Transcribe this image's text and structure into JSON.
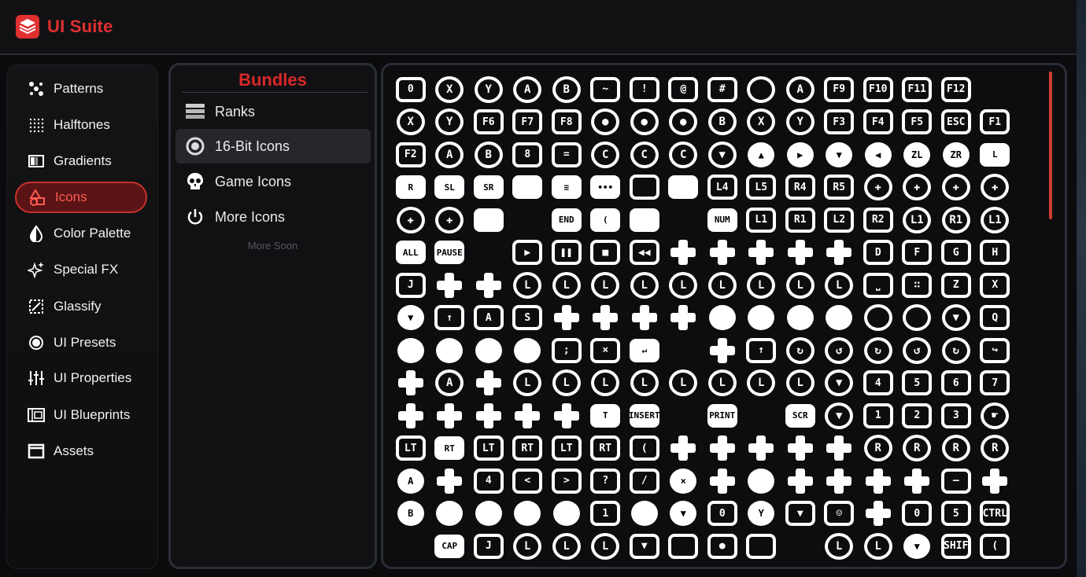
{
  "app": {
    "title": "UI Suite",
    "brand_color": "#e03030"
  },
  "sidebar": {
    "items": [
      {
        "label": "Patterns",
        "icon": "patterns-icon",
        "active": false
      },
      {
        "label": "Halftones",
        "icon": "halftones-icon",
        "active": false
      },
      {
        "label": "Gradients",
        "icon": "gradients-icon",
        "active": false
      },
      {
        "label": "Icons",
        "icon": "icons-icon",
        "active": true
      },
      {
        "label": "Color Palette",
        "icon": "color-palette-icon",
        "active": false
      },
      {
        "label": "Special FX",
        "icon": "sparkles-icon",
        "active": false
      },
      {
        "label": "Glassify",
        "icon": "glassify-icon",
        "active": false
      },
      {
        "label": "UI Presets",
        "icon": "presets-icon",
        "active": false
      },
      {
        "label": "UI Properties",
        "icon": "sliders-icon",
        "active": false
      },
      {
        "label": "UI Blueprints",
        "icon": "blueprints-icon",
        "active": false
      },
      {
        "label": "Assets",
        "icon": "assets-icon",
        "active": false
      }
    ]
  },
  "bundles": {
    "title": "Bundles",
    "items": [
      {
        "label": "Ranks",
        "icon": "ranks-icon",
        "active": false
      },
      {
        "label": "16-Bit Icons",
        "icon": "16bit-icon",
        "active": true
      },
      {
        "label": "Game Icons",
        "icon": "skull-icon",
        "active": false
      },
      {
        "label": "More Icons",
        "icon": "power-icon",
        "active": false
      }
    ],
    "more_soon": "More Soon"
  },
  "icon_grid": {
    "accent": "#d23c32",
    "cells": [
      [
        "sq",
        "0"
      ],
      [
        "circ",
        "X"
      ],
      [
        "circ",
        "Y"
      ],
      [
        "circ",
        "A"
      ],
      [
        "circ",
        "B"
      ],
      [
        "sq",
        "~"
      ],
      [
        "sq",
        "!"
      ],
      [
        "sq",
        "@"
      ],
      [
        "sq",
        "#"
      ],
      [
        "circ",
        ""
      ],
      [
        "circ",
        "A"
      ],
      [
        "sq",
        "F9"
      ],
      [
        "sq",
        "F10"
      ],
      [
        "sq",
        "F11"
      ],
      [
        "sq",
        "F12"
      ],
      [
        "none",
        ""
      ],
      [
        "circ",
        "X"
      ],
      [
        "circ",
        "Y"
      ],
      [
        "sq",
        "F6"
      ],
      [
        "sq",
        "F7"
      ],
      [
        "sq",
        "F8"
      ],
      [
        "circ",
        "●"
      ],
      [
        "circ",
        "●"
      ],
      [
        "circ",
        "●"
      ],
      [
        "circ",
        "B"
      ],
      [
        "circ",
        "X"
      ],
      [
        "circ",
        "Y"
      ],
      [
        "sq",
        "F3"
      ],
      [
        "sq",
        "F4"
      ],
      [
        "sq",
        "F5"
      ],
      [
        "sq",
        "ESC"
      ],
      [
        "sq",
        "F1"
      ],
      [
        "sq",
        "F2"
      ],
      [
        "circ",
        "A"
      ],
      [
        "circ",
        "B"
      ],
      [
        "sq",
        "8"
      ],
      [
        "sq",
        "="
      ],
      [
        "circ",
        "C"
      ],
      [
        "circ",
        "C"
      ],
      [
        "circ",
        "C"
      ],
      [
        "circ",
        "▼"
      ],
      [
        "fcirc",
        "▲"
      ],
      [
        "fcirc",
        "▶"
      ],
      [
        "fcirc",
        "▼"
      ],
      [
        "fcirc",
        "◀"
      ],
      [
        "fcirc",
        "ZL"
      ],
      [
        "fcirc",
        "ZR"
      ],
      [
        "fill",
        "L"
      ],
      [
        "fill",
        "R"
      ],
      [
        "fill",
        "SL"
      ],
      [
        "fill",
        "SR"
      ],
      [
        "fill",
        ""
      ],
      [
        "fill",
        "≡"
      ],
      [
        "fill",
        "•••"
      ],
      [
        "sq",
        ""
      ],
      [
        "fill",
        ""
      ],
      [
        "sq",
        "L4"
      ],
      [
        "sq",
        "L5"
      ],
      [
        "sq",
        "R4"
      ],
      [
        "sq",
        "R5"
      ],
      [
        "circ",
        "✚"
      ],
      [
        "circ",
        "✚"
      ],
      [
        "circ",
        "✚"
      ],
      [
        "circ",
        "✚"
      ],
      [
        "circ",
        "✚"
      ],
      [
        "circ",
        "✚"
      ],
      [
        "fill",
        ""
      ],
      [
        "none",
        ""
      ],
      [
        "fill",
        "END"
      ],
      [
        "fill",
        "("
      ],
      [
        "fill",
        ""
      ],
      [
        "none",
        ""
      ],
      [
        "fill",
        "NUM"
      ],
      [
        "sq",
        "L1"
      ],
      [
        "sq",
        "R1"
      ],
      [
        "sq",
        "L2"
      ],
      [
        "sq",
        "R2"
      ],
      [
        "circ",
        "L1"
      ],
      [
        "circ",
        "R1"
      ],
      [
        "circ",
        "L1"
      ],
      [
        "fill",
        "ALL"
      ],
      [
        "fill",
        "PAUSE"
      ],
      [
        "none",
        ""
      ],
      [
        "sq",
        "▶"
      ],
      [
        "sq",
        "❚❚"
      ],
      [
        "sq",
        "■"
      ],
      [
        "sq",
        "◀◀"
      ],
      [
        "dpad",
        ""
      ],
      [
        "dpad",
        ""
      ],
      [
        "dpad",
        ""
      ],
      [
        "dpad",
        ""
      ],
      [
        "dpad",
        ""
      ],
      [
        "sq",
        "D"
      ],
      [
        "sq",
        "F"
      ],
      [
        "sq",
        "G"
      ],
      [
        "sq",
        "H"
      ],
      [
        "sq",
        "J"
      ],
      [
        "dpad",
        ""
      ],
      [
        "dpad",
        ""
      ],
      [
        "circ",
        "L"
      ],
      [
        "circ",
        "L"
      ],
      [
        "circ",
        "L"
      ],
      [
        "circ",
        "L"
      ],
      [
        "circ",
        "L"
      ],
      [
        "circ",
        "L"
      ],
      [
        "circ",
        "L"
      ],
      [
        "circ",
        "L"
      ],
      [
        "circ",
        "L"
      ],
      [
        "sq",
        "⎵"
      ],
      [
        "sq",
        "∷"
      ],
      [
        "sq",
        "Z"
      ],
      [
        "sq",
        "X"
      ],
      [
        "fcirc",
        "▼"
      ],
      [
        "sq",
        "↑"
      ],
      [
        "sq",
        "A"
      ],
      [
        "sq",
        "S"
      ],
      [
        "dpad",
        ""
      ],
      [
        "dpad",
        ""
      ],
      [
        "dpad",
        ""
      ],
      [
        "dpad",
        ""
      ],
      [
        "fcirc",
        ""
      ],
      [
        "fcirc",
        ""
      ],
      [
        "fcirc",
        ""
      ],
      [
        "fcirc",
        ""
      ],
      [
        "circ",
        ""
      ],
      [
        "circ",
        ""
      ],
      [
        "circ",
        "▼"
      ],
      [
        "sq",
        "Q"
      ],
      [
        "fcirc",
        ""
      ],
      [
        "fcirc",
        ""
      ],
      [
        "fcirc",
        ""
      ],
      [
        "fcirc",
        ""
      ],
      [
        "sq",
        ";"
      ],
      [
        "sq",
        "×"
      ],
      [
        "fill",
        "↵"
      ],
      [
        "none",
        ""
      ],
      [
        "dpad",
        ""
      ],
      [
        "sq",
        "↑"
      ],
      [
        "circ",
        "↻"
      ],
      [
        "circ",
        "↺"
      ],
      [
        "circ",
        "↻"
      ],
      [
        "circ",
        "↺"
      ],
      [
        "circ",
        "↻"
      ],
      [
        "sq",
        "↪"
      ],
      [
        "dpad",
        ""
      ],
      [
        "circ",
        "A"
      ],
      [
        "dpad",
        ""
      ],
      [
        "circ",
        "L"
      ],
      [
        "circ",
        "L"
      ],
      [
        "circ",
        "L"
      ],
      [
        "circ",
        "L"
      ],
      [
        "circ",
        "L"
      ],
      [
        "circ",
        "L"
      ],
      [
        "circ",
        "L"
      ],
      [
        "circ",
        "L"
      ],
      [
        "circ",
        "▼"
      ],
      [
        "sq",
        "4"
      ],
      [
        "sq",
        "5"
      ],
      [
        "sq",
        "6"
      ],
      [
        "sq",
        "7"
      ],
      [
        "dpad",
        ""
      ],
      [
        "dpad",
        ""
      ],
      [
        "dpad",
        ""
      ],
      [
        "dpad",
        ""
      ],
      [
        "dpad",
        ""
      ],
      [
        "fill",
        "T"
      ],
      [
        "fill",
        "INSERT"
      ],
      [
        "none",
        ""
      ],
      [
        "fill",
        "PRINT"
      ],
      [
        "none",
        ""
      ],
      [
        "fill",
        "SCR"
      ],
      [
        "circ",
        "▼"
      ],
      [
        "sq",
        "1"
      ],
      [
        "sq",
        "2"
      ],
      [
        "sq",
        "3"
      ],
      [
        "circ",
        "☛"
      ],
      [
        "sq",
        "LT"
      ],
      [
        "fill",
        "RT"
      ],
      [
        "sq",
        "LT"
      ],
      [
        "sq",
        "RT"
      ],
      [
        "sq",
        "LT"
      ],
      [
        "sq",
        "RT"
      ],
      [
        "sq",
        "("
      ],
      [
        "dpad",
        ""
      ],
      [
        "dpad",
        ""
      ],
      [
        "dpad",
        ""
      ],
      [
        "dpad",
        ""
      ],
      [
        "dpad",
        ""
      ],
      [
        "circ",
        "R"
      ],
      [
        "circ",
        "R"
      ],
      [
        "circ",
        "R"
      ],
      [
        "circ",
        "R"
      ],
      [
        "fcirc",
        "A"
      ],
      [
        "dpad",
        ""
      ],
      [
        "sq",
        "4"
      ],
      [
        "sq",
        "<"
      ],
      [
        "sq",
        ">"
      ],
      [
        "sq",
        "?"
      ],
      [
        "sq",
        "/"
      ],
      [
        "fcirc",
        "×"
      ],
      [
        "dpad",
        ""
      ],
      [
        "fcirc",
        ""
      ],
      [
        "dpad",
        ""
      ],
      [
        "dpad",
        ""
      ],
      [
        "dpad",
        ""
      ],
      [
        "dpad",
        ""
      ],
      [
        "sq",
        "—"
      ],
      [
        "dpad",
        ""
      ],
      [
        "fcirc",
        "B"
      ],
      [
        "fcirc",
        ""
      ],
      [
        "fcirc",
        ""
      ],
      [
        "fcirc",
        ""
      ],
      [
        "fcirc",
        ""
      ],
      [
        "sq",
        "1"
      ],
      [
        "fcirc",
        ""
      ],
      [
        "fcirc",
        "▼"
      ],
      [
        "sq",
        "0"
      ],
      [
        "fcirc",
        "Y"
      ],
      [
        "sq",
        "▼"
      ],
      [
        "sq",
        "☺"
      ],
      [
        "dpad",
        ""
      ],
      [
        "sq",
        "0"
      ],
      [
        "sq",
        "5"
      ],
      [
        "sq",
        "CTRL"
      ],
      [
        "none",
        ""
      ],
      [
        "fill",
        "CAP"
      ],
      [
        "sq",
        "J"
      ],
      [
        "circ",
        "L"
      ],
      [
        "circ",
        "L"
      ],
      [
        "circ",
        "L"
      ],
      [
        "sq",
        "▼"
      ],
      [
        "sq",
        ""
      ],
      [
        "sq",
        "●"
      ],
      [
        "sq",
        ""
      ],
      [
        "none",
        ""
      ],
      [
        "circ",
        "L"
      ],
      [
        "circ",
        "L"
      ],
      [
        "fcirc",
        "▼"
      ],
      [
        "sq",
        "SHIF"
      ],
      [
        "sq",
        "("
      ]
    ]
  }
}
